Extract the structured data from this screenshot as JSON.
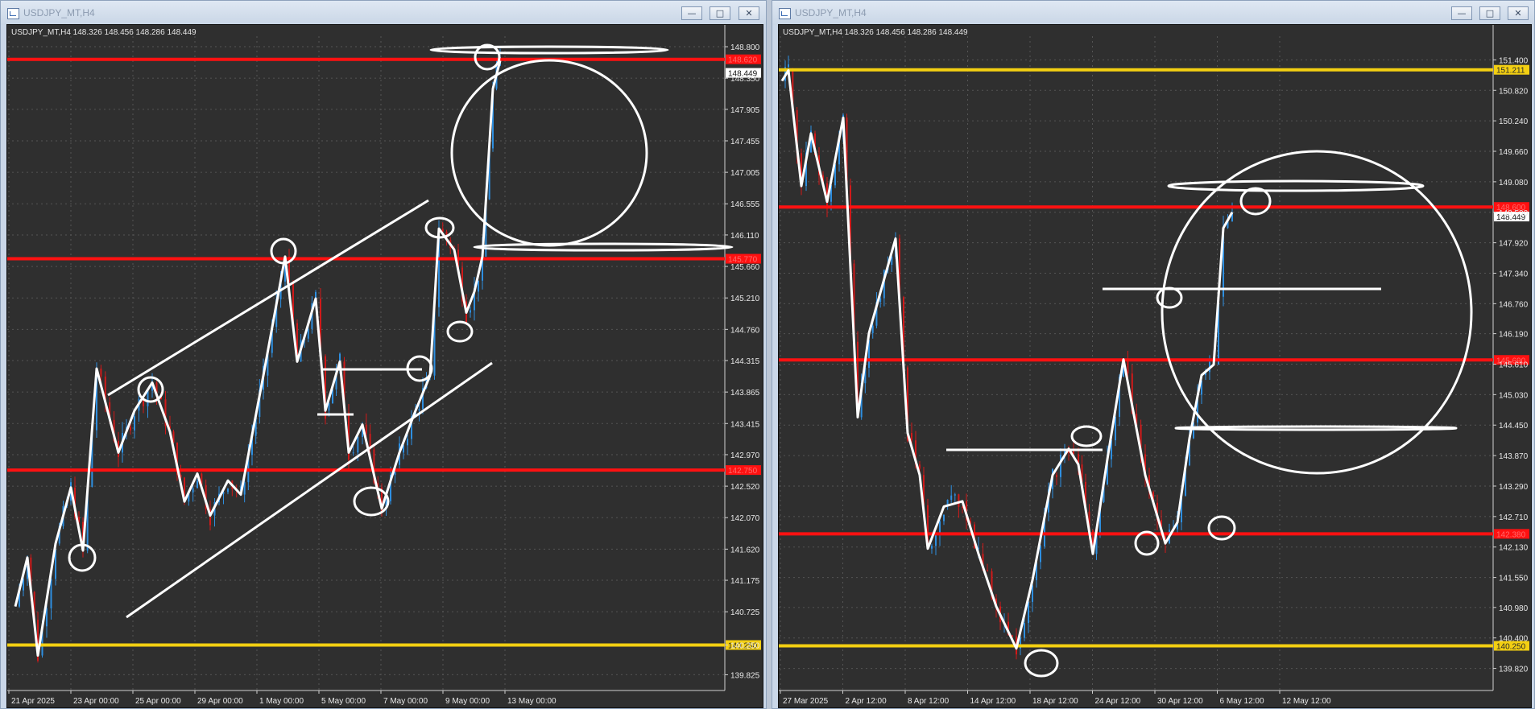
{
  "colors": {
    "chart_bg": "#2f2f2f",
    "grid": "#545454",
    "bull": "#2e8fe0",
    "bear": "#d01a1a",
    "red_level": "#ff1111",
    "yellow_level": "#f3cf12",
    "drawing": "#ffffff"
  },
  "left": {
    "window_title": "USDJPY_MT,H4",
    "header": "USDJPY_MT,H4  148.326 148.456 148.286 148.449",
    "price_ticks": [
      "148.800",
      "148.350",
      "147.905",
      "147.455",
      "147.005",
      "146.555",
      "146.110",
      "145.660",
      "145.210",
      "144.760",
      "144.315",
      "143.865",
      "143.415",
      "142.970",
      "142.520",
      "142.070",
      "141.620",
      "141.175",
      "140.725",
      "140.250",
      "139.825"
    ],
    "time_ticks": [
      "21 Apr 2025",
      "23 Apr 00:00",
      "25 Apr 00:00",
      "29 Apr 00:00",
      "1 May 00:00",
      "5 May 00:00",
      "7 May 00:00",
      "9 May 00:00",
      "13 May 00:00"
    ],
    "price_range": [
      139.6,
      148.95
    ],
    "levels": [
      {
        "price": 148.62,
        "color": "red",
        "badge": "148.620"
      },
      {
        "price": 145.77,
        "color": "red",
        "badge": "145.770"
      },
      {
        "price": 142.75,
        "color": "red",
        "badge": "142.750"
      },
      {
        "price": 140.25,
        "color": "yellow",
        "badge": "140.250"
      }
    ],
    "current_price": "148.449"
  },
  "right": {
    "window_title": "USDJPY_MT,H4",
    "header": "USDJPY_MT,H4  148.326 148.456 148.286 148.449",
    "price_ticks": [
      "151.400",
      "150.820",
      "150.240",
      "149.660",
      "149.080",
      "148.500",
      "147.920",
      "147.340",
      "146.760",
      "146.190",
      "145.610",
      "145.030",
      "144.450",
      "143.870",
      "143.290",
      "142.710",
      "142.130",
      "141.550",
      "140.980",
      "140.400",
      "139.820"
    ],
    "time_ticks": [
      "27 Mar 2025",
      "2 Apr 12:00",
      "8 Apr 12:00",
      "14 Apr 12:00",
      "18 Apr 12:00",
      "24 Apr 12:00",
      "30 Apr 12:00",
      "6 May 12:00",
      "12 May 12:00"
    ],
    "price_range": [
      139.4,
      151.85
    ],
    "levels": [
      {
        "price": 151.211,
        "color": "yellow",
        "badge": "151.211"
      },
      {
        "price": 148.6,
        "color": "red",
        "badge": "148.600"
      },
      {
        "price": 145.69,
        "color": "red",
        "badge": "145.690"
      },
      {
        "price": 142.38,
        "color": "red",
        "badge": "142.380"
      },
      {
        "price": 140.25,
        "color": "yellow",
        "badge": "140.250"
      }
    ],
    "current_price": "148.449"
  }
}
